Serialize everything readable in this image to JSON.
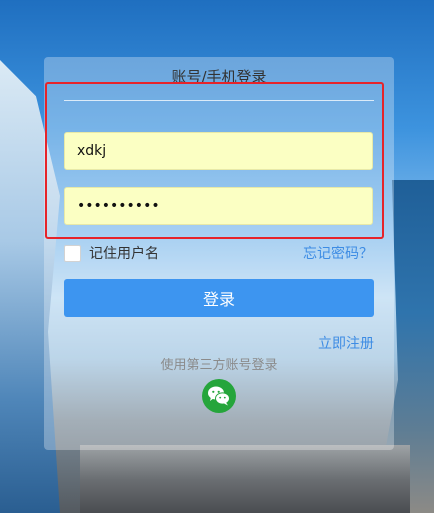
{
  "login": {
    "title": "账号/手机登录",
    "username_value": "xdkj",
    "password_mask": "••••••••••",
    "remember_label": "记住用户名",
    "forgot_label": "忘记密码？",
    "login_button_label": "登录",
    "register_label": "立即注册",
    "third_party_label": "使用第三方账号登录",
    "third_party_icon": "wechat-icon"
  },
  "colors": {
    "highlight_border": "#e6242a",
    "primary": "#3d95f0",
    "link": "#3d8ce4",
    "wechat": "#25a53b",
    "autofill": "#fbffc3"
  }
}
